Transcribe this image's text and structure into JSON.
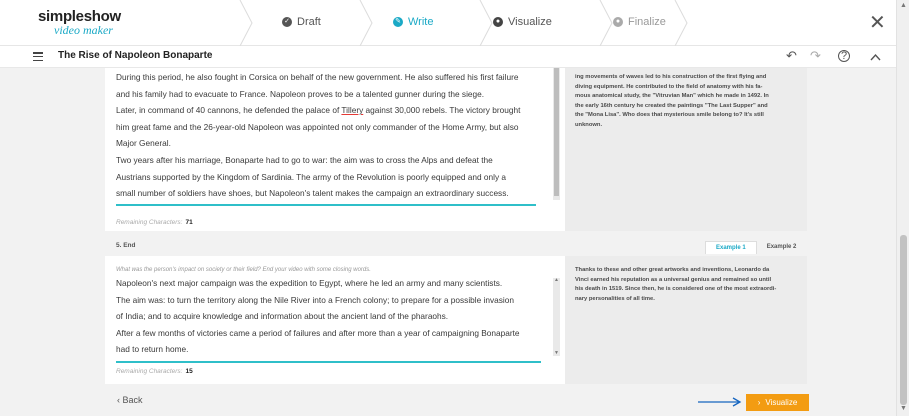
{
  "brand": {
    "line1": "simpleshow",
    "line2": "video maker"
  },
  "steps": [
    {
      "label": "Draft",
      "icon": "check-icon",
      "state": "done"
    },
    {
      "label": "Write",
      "icon": "pencil-icon",
      "state": "active"
    },
    {
      "label": "Visualize",
      "icon": "visualize-icon",
      "state": "todo"
    },
    {
      "label": "Finalize",
      "icon": "finalize-icon",
      "state": "todo"
    }
  ],
  "toolbar": {
    "title": "The Rise of Napoleon Bonaparte"
  },
  "section4": {
    "lines": [
      "During this period, he also fought in Corsica on behalf of the new government. He also suffered his first failure",
      "and his family had to evacuate to France. Napoleon proves to be a talented gunner during the siege.",
      "Later, in command of 40 cannons, he defended the palace of ",
      "him great fame and the 26-year-old Napoleon was appointed not only commander of the Home Army, but also",
      "Major General.",
      "Two years after his marriage, Bonaparte had to go to war: the aim was to cross the Alps and defeat the",
      "Austrians supported by the Kingdom of Sardinia. The army of the Revolution is poorly equipped and only a",
      "small number of soldiers have shoes, but Napoleon's talent makes the campaign an extraordinary success."
    ],
    "tillery_word": "Tillery",
    "line3_tail": " against 30,000 rebels. The victory brought",
    "remaining_label": "Remaining Characters:",
    "remaining_count": "71",
    "example_lines": [
      "ing movements of waves led to his construction of the first flying and",
      "diving equipment. He contributed to the field of anatomy with his fa-",
      "mous anatomical study, the \"Vitruvian Man\" which he made in 1492. In",
      "the early 16th century he created the paintings \"The Last Supper\" and",
      "the \"Mona Lisa\". Who does that mysterious smile belong to? It's still",
      "unknown."
    ]
  },
  "section5": {
    "label": "5. End",
    "tabs": [
      "Example 1",
      "Example 2"
    ],
    "hint": "What was the person's impact on society or their field? End your video with some closing words.",
    "lines": [
      "Napoleon's next major campaign was the expedition to Egypt, where he led an army and many scientists.",
      "The aim was: to turn the territory along the Nile River into a French colony; to prepare for a possible invasion",
      "of India; and to acquire knowledge and information about the ancient land of the pharaohs.",
      "After a few months of victories came a period of failures and after more than a year of campaigning Bonaparte",
      "had to return home."
    ],
    "remaining_label": "Remaining Characters:",
    "remaining_count": "15",
    "example_lines": [
      "Thanks to these and other great artworks and inventions, Leonardo da",
      "Vinci earned his reputation as a universal genius and remained so until",
      "his death in 1519. Since then, he is considered one of the most extraordi-",
      "nary personalities of all time."
    ]
  },
  "footer": {
    "back_label": "Back",
    "visualize_label": "Visualize"
  },
  "colors": {
    "accent": "#1aa9c6",
    "orange": "#f39c12",
    "arrow": "#1565c0",
    "teal": "#2fbfc9"
  }
}
